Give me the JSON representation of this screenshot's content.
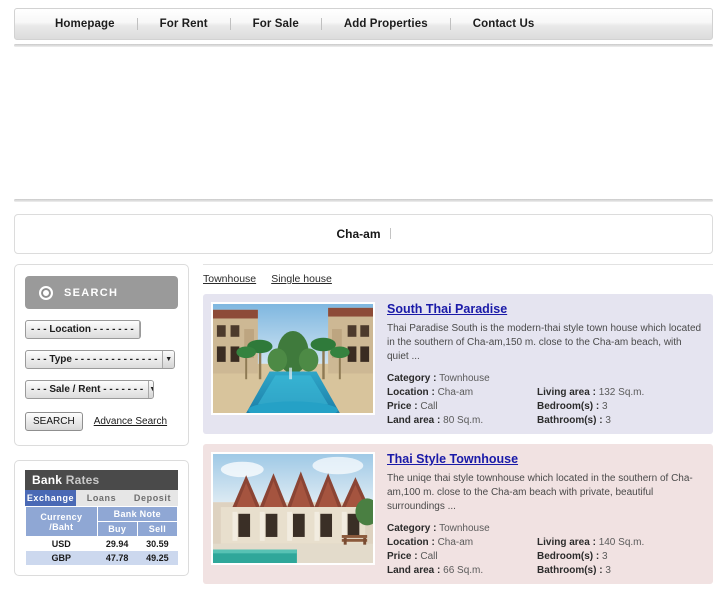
{
  "nav": {
    "items": [
      {
        "label": "Homepage"
      },
      {
        "label": "For Rent"
      },
      {
        "label": "For Sale"
      },
      {
        "label": "Add Properties"
      },
      {
        "label": "Contact Us"
      }
    ]
  },
  "title_bar": {
    "location": "Cha-am"
  },
  "search": {
    "heading": "SEARCH",
    "icon": "circle-bullet-icon",
    "selects": [
      {
        "name": "location",
        "value": "- - - Location - - - - - - -"
      },
      {
        "name": "type",
        "value": "- - - Type - - - - - - - - - - - - - -"
      },
      {
        "name": "sale-rent",
        "value": "- - - Sale / Rent - - - - - - -"
      }
    ],
    "submit_label": "SEARCH",
    "advance_label": "Advance Search"
  },
  "bank_rates": {
    "title_bold": "Bank",
    "title_light": "Rates",
    "tabs": [
      {
        "label": "Exchange",
        "active": true
      },
      {
        "label": "Loans",
        "active": false
      },
      {
        "label": "Deposit",
        "active": false
      }
    ],
    "header_currency": "Currency",
    "header_baht": "/Baht",
    "header_banknote": "Bank Note",
    "header_buy": "Buy",
    "header_sell": "Sell",
    "rows": [
      {
        "currency": "USD",
        "buy": "29.94",
        "sell": "30.59"
      },
      {
        "currency": "GBP",
        "buy": "47.78",
        "sell": "49.25"
      }
    ]
  },
  "categories": [
    {
      "label": "Townhouse"
    },
    {
      "label": "Single house"
    }
  ],
  "listings": [
    {
      "title": "South Thai Paradise",
      "description": "Thai Paradise South is the modern-thai style town house which located in the southern of Cha-am,150 m. close to the Cha-am beach, with quiet ...",
      "bg": "#e5e4f0",
      "image": "pool-courtyard-photo",
      "specs": {
        "category_label": "Category :",
        "category_value": "Townhouse",
        "location_label": "Location :",
        "location_value": "Cha-am",
        "price_label": "Price :",
        "price_value": "Call",
        "land_label": "Land area :",
        "land_value": "80 Sq.m.",
        "living_label": "Living area :",
        "living_value": "132 Sq.m.",
        "bedroom_label": "Bedroom(s) :",
        "bedroom_value": "3",
        "bathroom_label": "Bathroom(s) :",
        "bathroom_value": "3"
      }
    },
    {
      "title": "Thai Style Townhouse",
      "description": "The uniqe thai style townhouse which located in the southern of Cha-am,100 m. close to the Cha-am beach with private, beautiful surroundings ...",
      "bg": "#f1e2e2",
      "image": "thai-roof-townhouse-photo",
      "specs": {
        "category_label": "Category :",
        "category_value": "Townhouse",
        "location_label": "Location :",
        "location_value": "Cha-am",
        "price_label": "Price :",
        "price_value": "Call",
        "land_label": "Land area :",
        "land_value": "66 Sq.m.",
        "living_label": "Living area :",
        "living_value": "140 Sq.m.",
        "bedroom_label": "Bedroom(s) :",
        "bedroom_value": "3",
        "bathroom_label": "Bathroom(s) :",
        "bathroom_value": "3"
      }
    }
  ]
}
